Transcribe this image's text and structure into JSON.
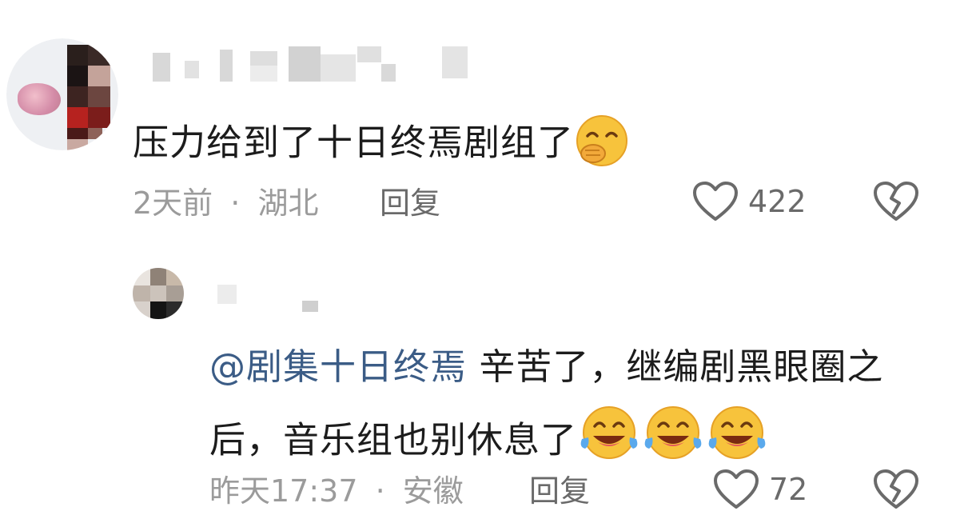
{
  "comments": [
    {
      "text": "压力给到了十日终焉剧组了",
      "emoji": "covering-mouth-smile",
      "time": "2天前",
      "location": "湖北",
      "separator": "·",
      "reply_label": "回复",
      "likes": "422"
    },
    {
      "mention": "@剧集十日终焉",
      "text": " 辛苦了，继编剧黑眼圈之后，音乐组也别休息了",
      "emojis": [
        "tears-of-joy",
        "tears-of-joy",
        "tears-of-joy"
      ],
      "time": "昨天17:37",
      "location": "安徽",
      "separator": "·",
      "reply_label": "回复",
      "likes": "72"
    }
  ],
  "colors": {
    "mention": "#3b5c86",
    "meta": "#9b9b9b",
    "action": "#6a6a6a",
    "text": "#1c1c1c"
  },
  "icons": [
    "heart-outline-icon",
    "broken-heart-icon"
  ]
}
